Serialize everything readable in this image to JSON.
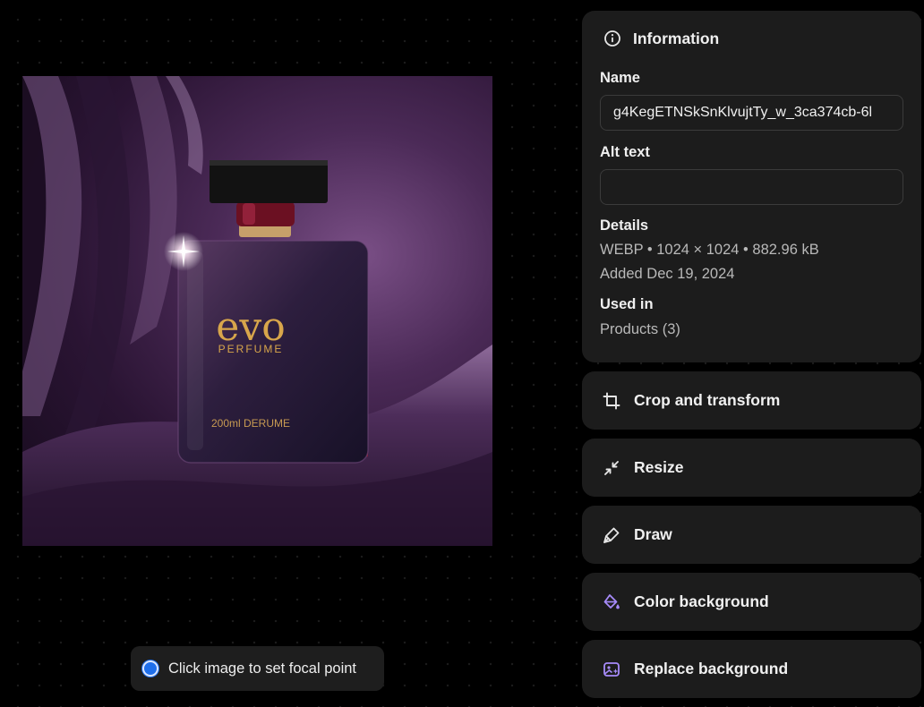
{
  "preview": {
    "bottle_brand": "evo",
    "bottle_subbrand": "PERFUME",
    "bottle_volume": "200ml DERUME"
  },
  "focal_hint": "Click image to set focal point",
  "info": {
    "title": "Information",
    "name_label": "Name",
    "name_value": "g4KegETNSkSnKlvujtTy_w_3ca374cb-6l",
    "alt_label": "Alt text",
    "alt_value": "",
    "details_label": "Details",
    "details_format": "WEBP • 1024 × 1024 • 882.96 kB",
    "details_added": "Added Dec 19, 2024",
    "used_in_label": "Used in",
    "used_in_value": "Products (3)"
  },
  "actions": [
    {
      "label": "Crop and transform",
      "icon": "crop-icon"
    },
    {
      "label": "Resize",
      "icon": "resize-icon"
    },
    {
      "label": "Draw",
      "icon": "draw-icon"
    },
    {
      "label": "Color background",
      "icon": "color-background-icon"
    },
    {
      "label": "Replace background",
      "icon": "replace-background-icon"
    }
  ],
  "colors": {
    "accent_blue": "#1f6feb",
    "ai_purple": "#a78bfa",
    "panel_bg": "#1c1c1c",
    "page_bg": "#000000"
  }
}
